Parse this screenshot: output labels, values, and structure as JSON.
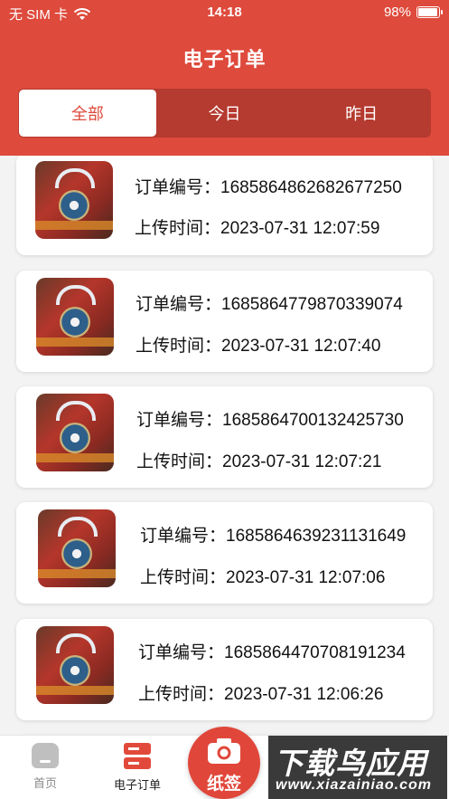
{
  "status_bar": {
    "carrier": "无 SIM 卡",
    "time": "14:18",
    "battery": "98%"
  },
  "header": {
    "title": "电子订单",
    "tabs": [
      {
        "label": "全部",
        "active": true
      },
      {
        "label": "今日",
        "active": false
      },
      {
        "label": "昨日",
        "active": false
      }
    ]
  },
  "orders": [
    {
      "order_label": "订单编号：",
      "order_no": "1685864862682677250",
      "time_label": "上传时间：",
      "upload_time": "2023-07-31 12:07:59"
    },
    {
      "order_label": "订单编号：",
      "order_no": "1685864779870339074",
      "time_label": "上传时间：",
      "upload_time": "2023-07-31 12:07:40"
    },
    {
      "order_label": "订单编号：",
      "order_no": "1685864700132425730",
      "time_label": "上传时间：",
      "upload_time": "2023-07-31 12:07:21"
    },
    {
      "order_label": "订单编号：",
      "order_no": "1685864639231131649",
      "time_label": "上传时间：",
      "upload_time": "2023-07-31 12:07:06"
    },
    {
      "order_label": "订单编号：",
      "order_no": "1685864470708191234",
      "time_label": "上传时间：",
      "upload_time": "2023-07-31 12:06:26"
    }
  ],
  "bottom_nav": {
    "home_label": "首页",
    "orders_label": "电子订单",
    "sign_label": "纸签"
  },
  "watermark": {
    "main": "下载鸟应用",
    "sub": "www.xiazainiao.com"
  },
  "colors": {
    "brand": "#de4a3c",
    "tab_track": "#b53a2f"
  },
  "icons": [
    "wifi-icon",
    "battery-icon",
    "home-icon",
    "order-list-icon",
    "camera-icon"
  ]
}
